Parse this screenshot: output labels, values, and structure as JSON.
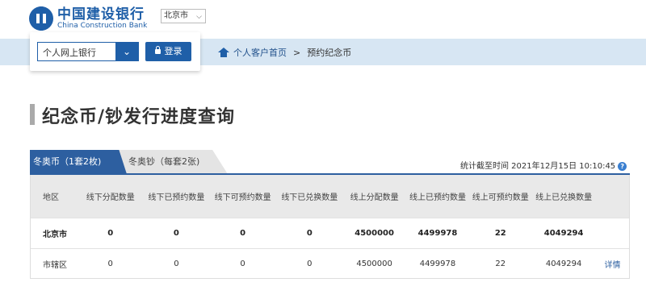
{
  "brand": {
    "name_cn": "中国建设银行",
    "name_en": "China Construction Bank"
  },
  "city_select": {
    "value": "北京市"
  },
  "login": {
    "bank_select_value": "个人网上银行",
    "login_label": "登录"
  },
  "breadcrumb": {
    "home": "个人客户首页",
    "separator": ">",
    "current": "预约纪念币"
  },
  "page_title": "纪念币/钞发行进度查询",
  "tabs": [
    {
      "label": "冬奥币（1套2枚)",
      "active": true
    },
    {
      "label": "冬奥钞（每套2张)",
      "active": false
    }
  ],
  "stat_time": "统计截至时间 2021年12月15日 10:10:45",
  "table": {
    "columns": [
      "地区",
      "线下分配数量",
      "线下已预约数量",
      "线下可预约数量",
      "线下已兑换数量",
      "线上分配数量",
      "线上已预约数量",
      "线上可预约数量",
      "线上已兑换数量",
      ""
    ],
    "rows": [
      {
        "region": "北京市",
        "offline_alloc": "0",
        "offline_reserved": "0",
        "offline_available": "0",
        "offline_exchanged": "0",
        "online_alloc": "4500000",
        "online_reserved": "4499978",
        "online_available": "22",
        "online_exchanged": "4049294",
        "action": ""
      },
      {
        "region": "市辖区",
        "offline_alloc": "0",
        "offline_reserved": "0",
        "offline_available": "0",
        "offline_exchanged": "0",
        "online_alloc": "4500000",
        "online_reserved": "4499978",
        "online_available": "22",
        "online_exchanged": "4049294",
        "action": "详情"
      }
    ]
  },
  "colors": {
    "brand_blue": "#1f5fa8",
    "tab_blue": "#2d5fa0",
    "nav_band": "#d7e6f3"
  }
}
